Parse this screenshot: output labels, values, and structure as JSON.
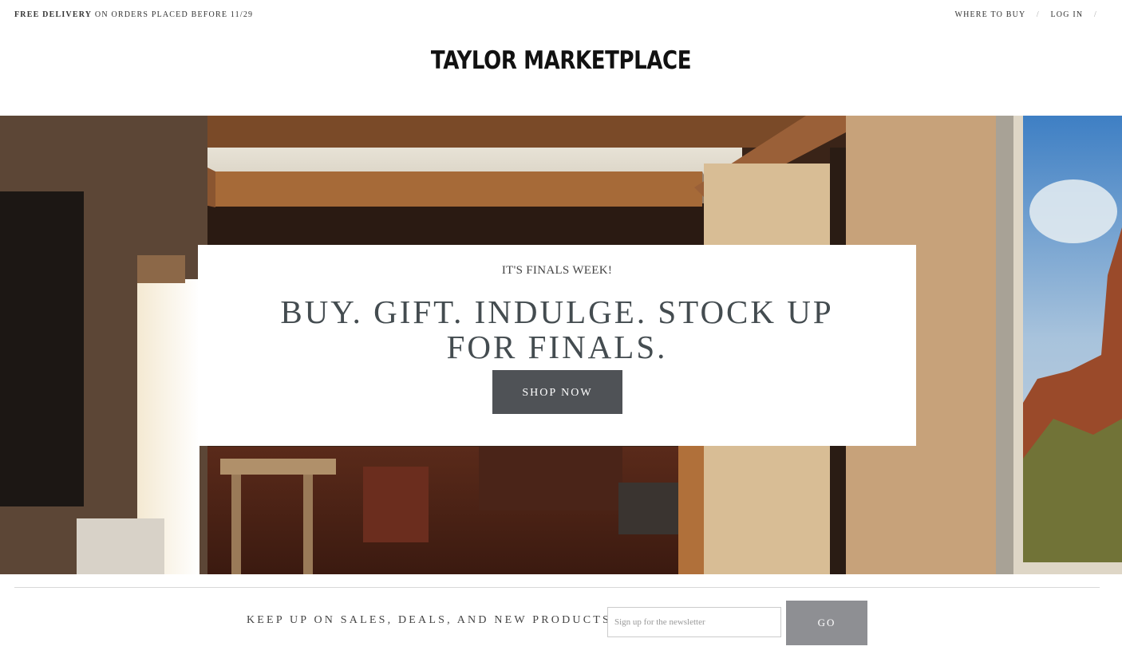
{
  "topbar": {
    "promo_bold": "FREE DELIVERY",
    "promo_rest": "ON ORDERS PLACED BEFORE 11/29",
    "links": [
      "WHERE TO BUY",
      "LOG IN"
    ],
    "separator": "/"
  },
  "header": {
    "logo": "TAYLOR MARKETPLACE"
  },
  "hero": {
    "eyebrow": "IT'S FINALS WEEK!",
    "headline": "BUY. GIFT. INDULGE. STOCK UP FOR FINALS.",
    "cta_label": "SHOP NOW"
  },
  "newsletter": {
    "label": "KEEP UP ON SALES, DEALS, AND NEW PRODUCTS",
    "placeholder": "Sign up for the newsletter",
    "submit_label": "GO"
  },
  "colors": {
    "cta_background": "#4f5256",
    "go_background": "#8e8f93",
    "headline_text": "#444c50"
  }
}
